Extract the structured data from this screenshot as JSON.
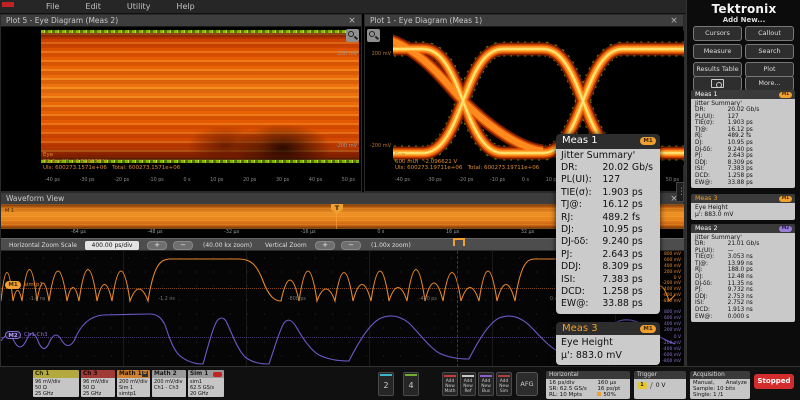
{
  "menu": {
    "items": [
      "File",
      "Edit",
      "Utility",
      "Help"
    ]
  },
  "plot5": {
    "title": "Plot 5 - Eye Diagram (Meas 2)",
    "close": "×",
    "scale_top": "200 mV",
    "scale_bottom": "-200 mV",
    "readout": [
      "Eye",
      "92.6 mUI   -4.829877 V",
      "UIs: 600273.1571e+06   Total: 600273.1571e+06"
    ],
    "ticks": [
      "-40 ps",
      "-30 ps",
      "-20 ps",
      "-10 ps",
      "0 s",
      "10 ps",
      "20 ps",
      "30 ps",
      "40 ps",
      "50 ps"
    ]
  },
  "plot1": {
    "title": "Plot 1 - Eye Diagram (Meas 1)",
    "close": "×",
    "scale_top": "200 mV",
    "scale_bottom": "-200 mV",
    "readout": [
      "Eye",
      "600 mUI   -2.096621 V",
      "UIs: 600273.19711e+06   Total: 600273.19711e+06"
    ],
    "ticks": [
      "-40 ps",
      "-30 ps",
      "-20 ps",
      "-10 ps",
      "0 s",
      "10 ps",
      "20 ps",
      "30 ps",
      "40 ps",
      "50 ps"
    ]
  },
  "waveform": {
    "title": "Waveform View",
    "close": "×",
    "m1_overview_label": "M 1",
    "trigger_marker": "T",
    "overview_ticks": [
      "-64 µs",
      "-48 µs",
      "-32 µs",
      "-16 µs",
      "0 s",
      "16 µs",
      "32 µs",
      "48 µs"
    ],
    "zoom": {
      "label": "Horizontal Zoom Scale",
      "scale_value": "400.00 ps/div",
      "plus": "+",
      "minus": "−",
      "h_zoom": "(40.00 kx zoom)",
      "v_label": "Vertical Zoom",
      "v_zoom": "(1.00x zoom)"
    },
    "x_ticks": [
      "-1.6 ns",
      "-1.2 ns",
      "-800 ps",
      "-400 ps",
      "0 s"
    ],
    "trace1": {
      "badge": "M1",
      "label": "simtp1",
      "color": "#e8872a"
    },
    "trace2": {
      "badge": "M2",
      "label": "Ch1-Ch3",
      "color": "#8a6fd0"
    },
    "scale1": [
      "800 mV",
      "600 mV",
      "400 mV",
      "200 mV",
      "0 V",
      "-200 mV",
      "-400 mV",
      "-600 mV",
      "-800 mV"
    ],
    "scale2": [
      "800 mV",
      "600 mV",
      "400 mV",
      "200 mV",
      "0 V",
      "-200 mV",
      "-400 mV",
      "-600 mV",
      "-800 mV"
    ]
  },
  "meas1": {
    "title": "Meas 1",
    "badge": "M1",
    "subtitle": "Jitter Summary'",
    "rows": [
      {
        "k": "DR:",
        "v": "20.02 Gb/s"
      },
      {
        "k": "PL(UI):",
        "v": "127"
      },
      {
        "k": "TIE(σ):",
        "v": "1.903 ps"
      },
      {
        "k": "TJ@:",
        "v": "16.12 ps"
      },
      {
        "k": "RJ:",
        "v": "489.2 fs"
      },
      {
        "k": "DJ:",
        "v": "10.95 ps"
      },
      {
        "k": "DJ-δδ:",
        "v": "9.240 ps"
      },
      {
        "k": "PJ:",
        "v": "2.643 ps"
      },
      {
        "k": "DDJ:",
        "v": "8.309 ps"
      },
      {
        "k": "ISI:",
        "v": "7.383 ps"
      },
      {
        "k": "DCD:",
        "v": "1.258 ps"
      },
      {
        "k": "EW@:",
        "v": "33.88 ps"
      }
    ]
  },
  "meas3": {
    "title": "Meas 3",
    "badge": "M1",
    "line1": "Eye Height",
    "line2": "µ': 883.0 mV"
  },
  "meas2": {
    "title": "Meas 2",
    "badge": "M2",
    "subtitle": "Jitter Summary'",
    "rows": [
      {
        "k": "DR:",
        "v": "21.01 Gb/s"
      },
      {
        "k": "PL(UI):",
        "v": "—"
      },
      {
        "k": "TIE(σ):",
        "v": "3.053 ns"
      },
      {
        "k": "TJ@:",
        "v": "13.99 ns"
      },
      {
        "k": "RJ:",
        "v": "188.0 ps"
      },
      {
        "k": "DJ:",
        "v": "12.48 ns"
      },
      {
        "k": "DJ-δδ:",
        "v": "11.35 ns"
      },
      {
        "k": "PJ:",
        "v": "9.732 ns"
      },
      {
        "k": "DDJ:",
        "v": "2.753 ns"
      },
      {
        "k": "ISI:",
        "v": "2.752 ns"
      },
      {
        "k": "DCD:",
        "v": "1.913 ns"
      },
      {
        "k": "EW@:",
        "v": "0.000 s"
      }
    ]
  },
  "rail": {
    "brand": "Tektronix",
    "add_new": "Add New...",
    "buttons": [
      "Cursors",
      "Callout",
      "Measure",
      "Search",
      "Results Table",
      "Plot"
    ],
    "more_label": "More..."
  },
  "bottom": {
    "badges": [
      {
        "title": "Ch 1",
        "lines": [
          "96 mV/div",
          "50 Ω",
          "25 GHz"
        ]
      },
      {
        "title": "Ch 3",
        "lines": [
          "96 mV/div",
          "50 Ω",
          "25 GHz"
        ]
      },
      {
        "title": "Math 1",
        "chip": "D",
        "lines": [
          "200 mV/div",
          "Sim 1",
          "simtp1"
        ]
      },
      {
        "title": "Math 2",
        "lines": [
          "200 mV/div",
          "Ch1 - Ch3"
        ]
      },
      {
        "title": "Sim 1",
        "lines": [
          "sim1",
          "62.5 GS/s",
          "20 GHz"
        ]
      }
    ],
    "channel_buttons": [
      {
        "label": "2"
      },
      {
        "label": "4"
      }
    ],
    "add_buttons": [
      {
        "label": "Add New Math"
      },
      {
        "label": "Add New Ref"
      },
      {
        "label": "Add New Bus"
      },
      {
        "label": "Add New Sim"
      }
    ],
    "afg": "AFG",
    "horizontal": {
      "title": "Horizontal",
      "rows": [
        {
          "k": "16 ps/div",
          "v": "160 µs"
        },
        {
          "k": "SR: 62.5 GS/s",
          "v": "16 ps/pt"
        },
        {
          "k": "RL: 10 Mpts",
          "v": "50%"
        }
      ]
    },
    "trigger": {
      "title": "Trigger",
      "source": "1",
      "level": "0 V"
    },
    "acquisition": {
      "title": "Acquisition",
      "row1_left": "Manual,",
      "row1_right": "Analyze",
      "row2": "Sample: 10 bits",
      "row3": "Single: 1 /1"
    },
    "run_state": "Stopped"
  },
  "colors": {
    "accent_orange": "#f0a030",
    "accent_purple": "#8a6fd0",
    "ch1_yellow": "#b3a93f",
    "ch3_red": "#a03a36",
    "math1_orange": "#cd7f32",
    "stopped_red": "#d22c2c",
    "trace1_orange": "#e8872a",
    "trace2_purple": "#6f58c8"
  }
}
